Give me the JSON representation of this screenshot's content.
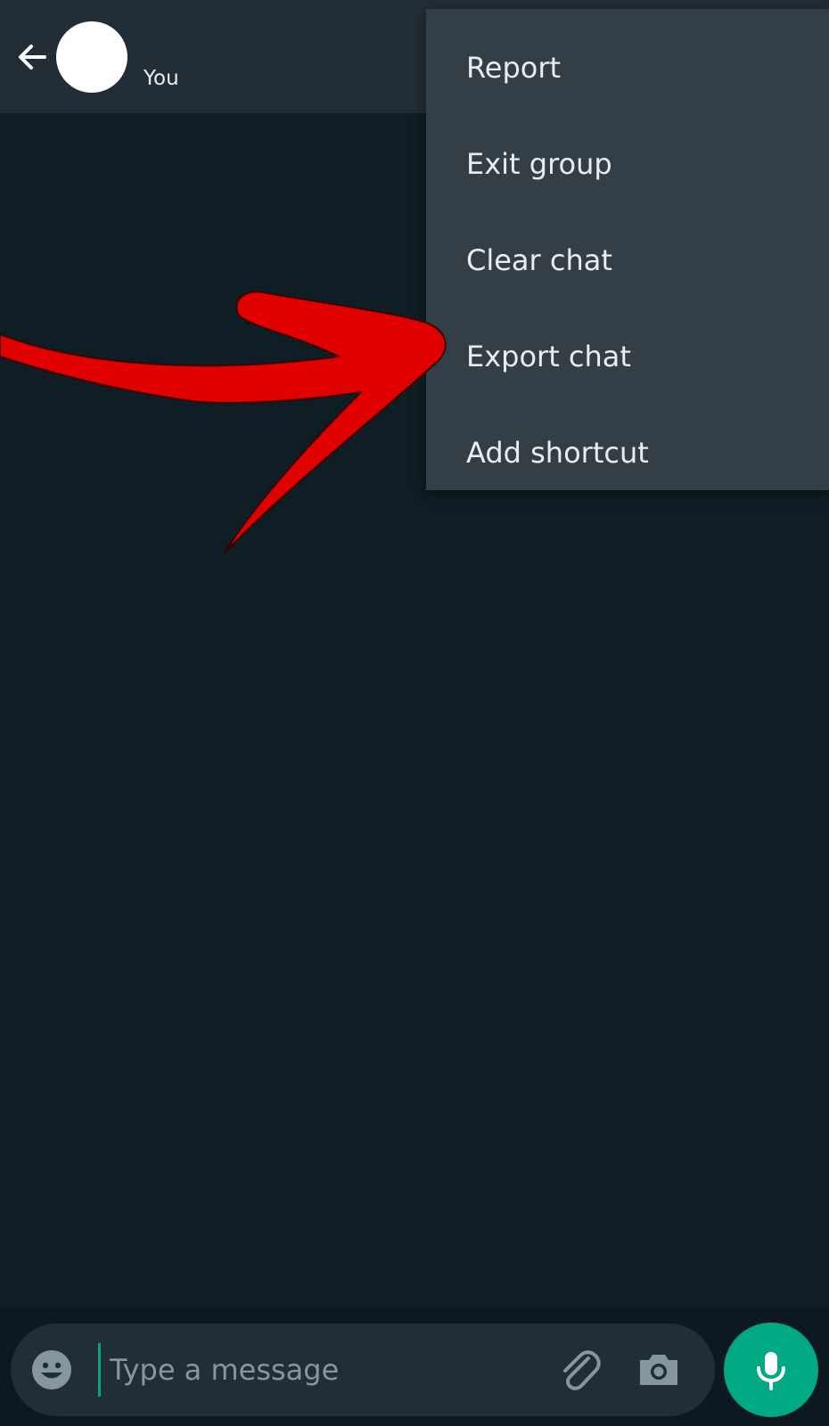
{
  "header": {
    "subtitle": "You",
    "back_icon": "arrow-left-icon"
  },
  "menu": {
    "items": [
      {
        "label": "Report"
      },
      {
        "label": "Exit group"
      },
      {
        "label": "Clear chat"
      },
      {
        "label": "Export chat"
      },
      {
        "label": "Add shortcut"
      }
    ]
  },
  "composer": {
    "placeholder": "Type a message",
    "emoji_icon": "emoji-icon",
    "attach_icon": "paperclip-icon",
    "camera_icon": "camera-icon",
    "mic_icon": "microphone-icon"
  },
  "colors": {
    "header_bg": "#232d36",
    "chat_bg": "#0f1d25",
    "menu_bg": "#333e46",
    "accent": "#00a884",
    "annotation_arrow": "#e00000"
  }
}
